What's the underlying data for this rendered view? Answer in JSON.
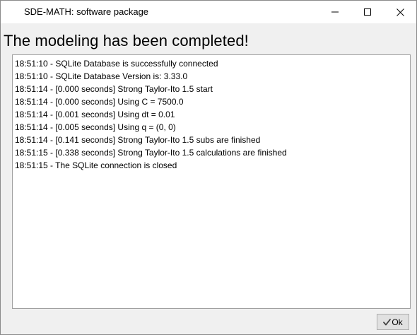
{
  "window": {
    "title": "SDE-MATH: software package"
  },
  "heading": "The modeling has been completed!",
  "log": [
    "18:51:10 - SQLite Database is successfully connected",
    "18:51:10 - SQLite Database Version is: 3.33.0",
    "18:51:14 - [0.000 seconds] Strong Taylor-Ito 1.5 start",
    "18:51:14 - [0.000 seconds] Using C = 7500.0",
    "18:51:14 - [0.001 seconds] Using dt = 0.01",
    "18:51:14 - [0.005 seconds] Using q = (0, 0)",
    "18:51:14 - [0.141 seconds] Strong Taylor-Ito 1.5 subs are finished",
    "18:51:15 - [0.338 seconds] Strong Taylor-Ito 1.5 calculations are finished",
    "18:51:15 - The SQLite connection is closed"
  ],
  "ok_button": {
    "label": "Ok",
    "icon": "checkmark-icon"
  },
  "colors": {
    "window_bg": "#f0f0f0",
    "titlebar_bg": "#ffffff",
    "checkmark": "#2e7d32"
  }
}
